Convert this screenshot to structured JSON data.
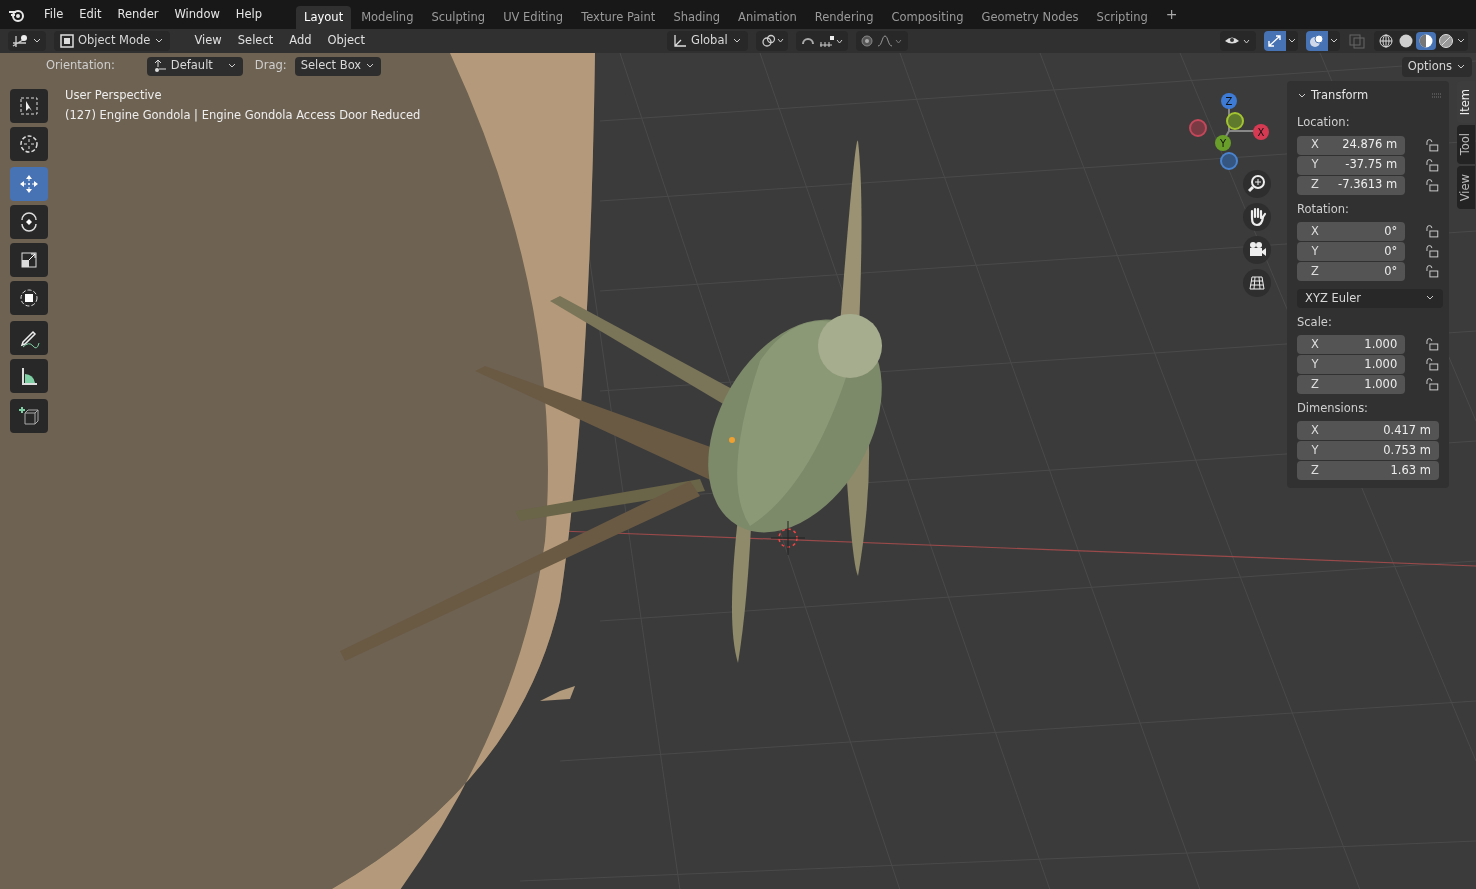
{
  "menu": [
    "File",
    "Edit",
    "Render",
    "Window",
    "Help"
  ],
  "workspaces": [
    {
      "label": "Layout",
      "selected": true
    },
    {
      "label": "Modeling",
      "selected": false
    },
    {
      "label": "Sculpting",
      "selected": false
    },
    {
      "label": "UV Editing",
      "selected": false
    },
    {
      "label": "Texture Paint",
      "selected": false
    },
    {
      "label": "Shading",
      "selected": false
    },
    {
      "label": "Animation",
      "selected": false
    },
    {
      "label": "Rendering",
      "selected": false
    },
    {
      "label": "Compositing",
      "selected": false
    },
    {
      "label": "Geometry Nodes",
      "selected": false
    },
    {
      "label": "Scripting",
      "selected": false
    }
  ],
  "add_workspace": "+",
  "header": {
    "mode": "Object Mode",
    "menus": [
      "View",
      "Select",
      "Add",
      "Object"
    ],
    "orientation": "Global",
    "shading": [
      {
        "kind": "wireframe",
        "selected": false
      },
      {
        "kind": "solid",
        "selected": false
      },
      {
        "kind": "material",
        "selected": true
      },
      {
        "kind": "rendered",
        "selected": false
      }
    ]
  },
  "tool_settings": {
    "orientation_label": "Orientation:",
    "orientation": "Default",
    "drag_label": "Drag:",
    "drag": "Select Box",
    "options": "Options"
  },
  "tools": [
    {
      "kind": "select",
      "selected": false
    },
    {
      "kind": "cursor",
      "selected": false
    },
    {
      "kind": "move",
      "selected": true
    },
    {
      "kind": "rotate",
      "selected": false
    },
    {
      "kind": "scale",
      "selected": false
    },
    {
      "kind": "transform",
      "selected": false
    },
    {
      "kind": "annotate",
      "selected": false
    },
    {
      "kind": "measure",
      "selected": false
    },
    {
      "kind": "add-cube",
      "selected": false
    }
  ],
  "viewport": {
    "view": "User Perspective",
    "object": "(127) Engine Gondola | Engine Gondola Access Door Reduced",
    "gizmo": {
      "z": "Z",
      "x": "X",
      "y": "Y"
    }
  },
  "sidebar_tabs": [
    {
      "label": "Item",
      "selected": true
    },
    {
      "label": "Tool",
      "selected": false
    },
    {
      "label": "View",
      "selected": false
    }
  ],
  "transform": {
    "title": "Transform",
    "groups": [
      {
        "label": "Location:",
        "lockable": true,
        "fields": [
          {
            "axis": "X",
            "value": "24.876 m"
          },
          {
            "axis": "Y",
            "value": "-37.75 m"
          },
          {
            "axis": "Z",
            "value": "-7.3613 m"
          }
        ]
      },
      {
        "label": "Rotation:",
        "lockable": true,
        "fields": [
          {
            "axis": "X",
            "value": "0°"
          },
          {
            "axis": "Y",
            "value": "0°"
          },
          {
            "axis": "Z",
            "value": "0°"
          }
        ],
        "mode": "XYZ Euler"
      },
      {
        "label": "Scale:",
        "lockable": true,
        "fields": [
          {
            "axis": "X",
            "value": "1.000"
          },
          {
            "axis": "Y",
            "value": "1.000"
          },
          {
            "axis": "Z",
            "value": "1.000"
          }
        ]
      },
      {
        "label": "Dimensions:",
        "lockable": false,
        "fields": [
          {
            "axis": "X",
            "value": "0.417 m"
          },
          {
            "axis": "Y",
            "value": "0.753 m"
          },
          {
            "axis": "Z",
            "value": "1.63 m"
          }
        ]
      }
    ]
  }
}
